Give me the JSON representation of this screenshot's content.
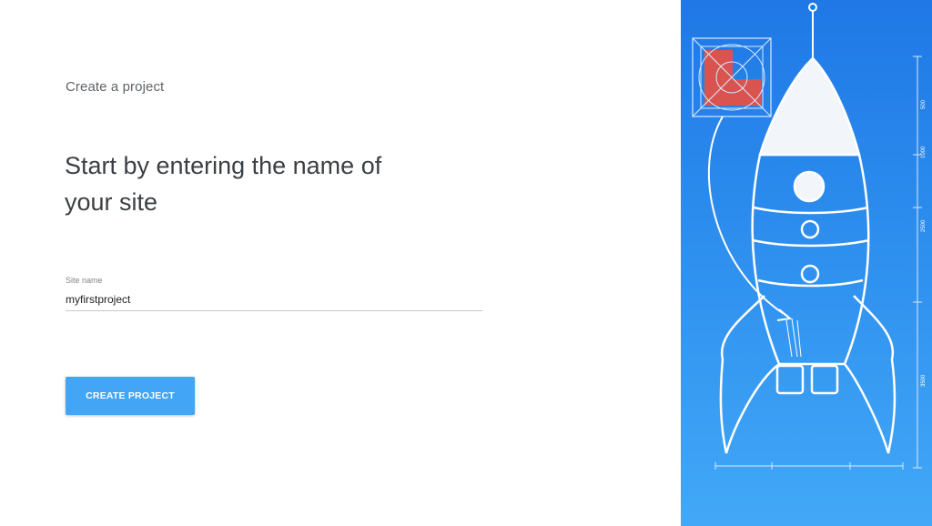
{
  "colors": {
    "accent": "#42a5f5",
    "hero_top": "#1f78e6",
    "hero_bottom": "#42a8f7",
    "logo_red": "#d9534f"
  },
  "page": {
    "step_label": "Create a project",
    "headline": "Start by entering the name of your site"
  },
  "form": {
    "site_name_label": "Site name",
    "site_name_value": "myfirstproject"
  },
  "actions": {
    "create_label": "CREATE PROJECT"
  },
  "illustration": {
    "icon": "rocket-blueprint-illustration",
    "dimension_labels": [
      "500",
      "1000",
      "2500",
      "3500"
    ]
  }
}
